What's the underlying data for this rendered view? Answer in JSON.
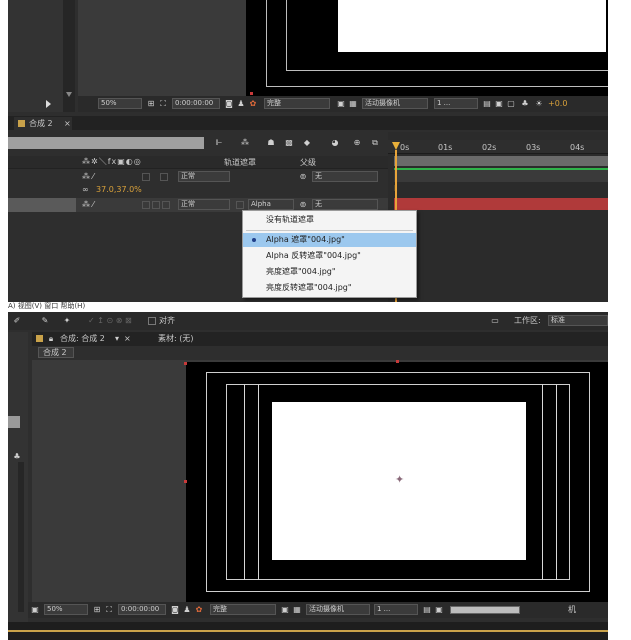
{
  "top": {
    "viewer_bar": {
      "zoom": "50%",
      "timecode": "0:00:00:00",
      "resolution": "完整",
      "camera": "活动摄像机",
      "views": "1 ...",
      "exposure": "+0.0"
    },
    "timeline": {
      "tab_label": "合成 2",
      "tab_close": "×",
      "column_mask": "轨道遮罩",
      "column_parent": "父级",
      "scale_value": "37.0,37.0%",
      "layer1_mode": "正常",
      "layer1_parent": "无",
      "layer2_mode": "正常",
      "layer2_track": "Alpha",
      "layer2_parent": "无",
      "ruler": [
        "0s",
        "01s",
        "02s",
        "03s",
        "04s"
      ]
    },
    "menu": {
      "items": [
        "没有轨道遮罩",
        "Alpha 遮罩\"004.jpg\"",
        "Alpha 反转遮罩\"004.jpg\"",
        "亮度遮罩\"004.jpg\"",
        "亮度反转遮罩\"004.jpg\""
      ],
      "selected_index": 1
    }
  },
  "bottom": {
    "menubar_partial": "A) 视图(V) 窗口 帮助(H)",
    "toolbar": {
      "snap_label": "对齐",
      "workspace_label": "工作区:",
      "workspace_value": "标准"
    },
    "comp_header": {
      "comp_title": "合成: 合成 2",
      "footage_label": "素材: (无)",
      "breadcrumb": "合成 2"
    },
    "viewer_bar": {
      "zoom": "50%",
      "timecode": "0:00:00:00",
      "resolution": "完整",
      "camera": "活动摄像机",
      "views": "1 ...",
      "right_label": "机"
    }
  },
  "colors": {
    "panel": "#2e2e2e",
    "selection": "#9cc8ee",
    "accent": "#d9a13a",
    "red_bar": "#b03a3a"
  }
}
